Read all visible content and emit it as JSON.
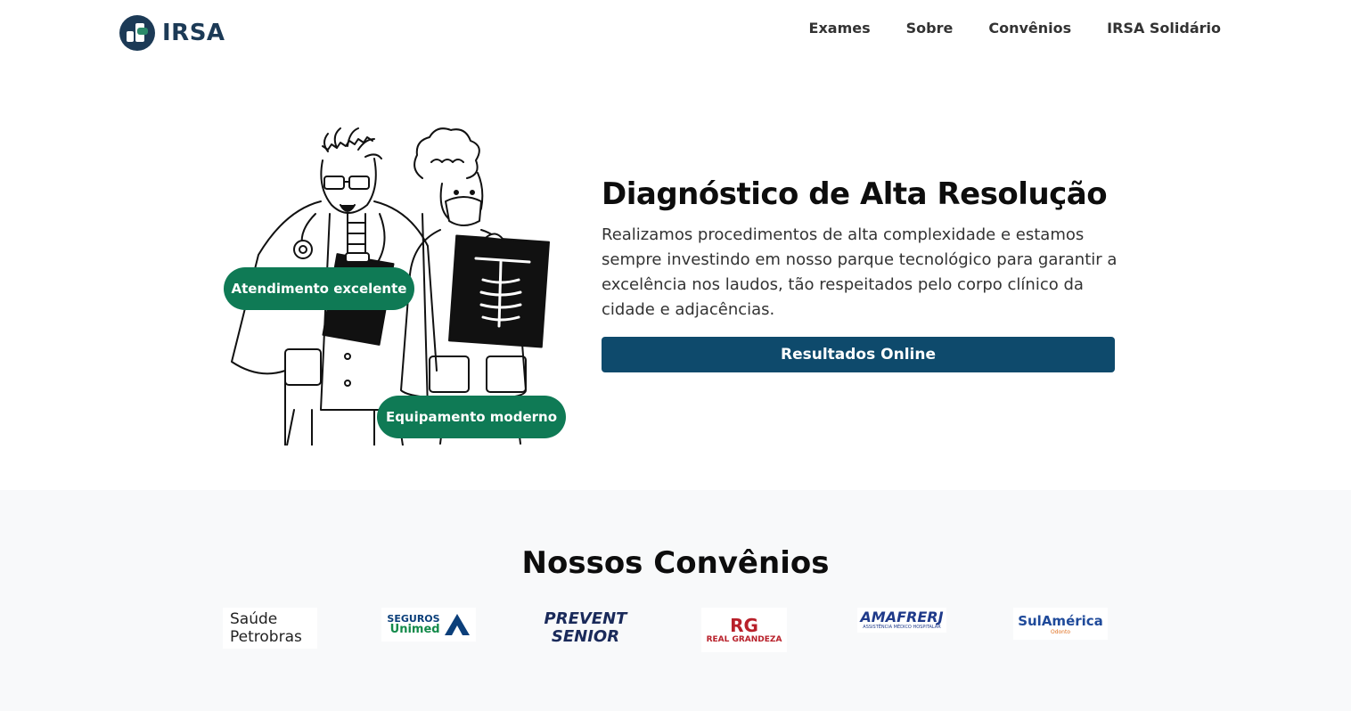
{
  "header": {
    "logo_text": "IRSA",
    "nav": [
      "Exames",
      "Sobre",
      "Convênios",
      "IRSA Solidário"
    ]
  },
  "hero": {
    "badges": [
      "Atendimento excelente",
      "Equipamento moderno"
    ],
    "title": "Diagnóstico de Alta Resolução",
    "description": "Realizamos procedimentos de alta complexidade e estamos sempre investindo em nosso parque tecnológico para garantir a excelência nos laudos, tão respeitados pelo corpo clínico da cidade e adjacências.",
    "cta_label": "Resultados Online"
  },
  "partners": {
    "title": "Nossos Convênios",
    "logos": [
      {
        "line1": "Saúde",
        "line2": "Petrobras"
      },
      {
        "line1": "SEGUROS",
        "line2": "Unimed"
      },
      {
        "line1": "PREVENT",
        "line2": "SENIOR"
      },
      {
        "symbol": "RG",
        "name": "REAL GRANDEZA"
      },
      {
        "name": "AMAFRERJ",
        "sub": "ASSISTÊNCIA MÉDICO HOSPITALAR"
      },
      {
        "name": "SulAmérica",
        "sub": "Odonto"
      }
    ]
  },
  "colors": {
    "brand": "#1c3a56",
    "accent_green": "#0f7a55",
    "cta": "#0e4a6c"
  }
}
